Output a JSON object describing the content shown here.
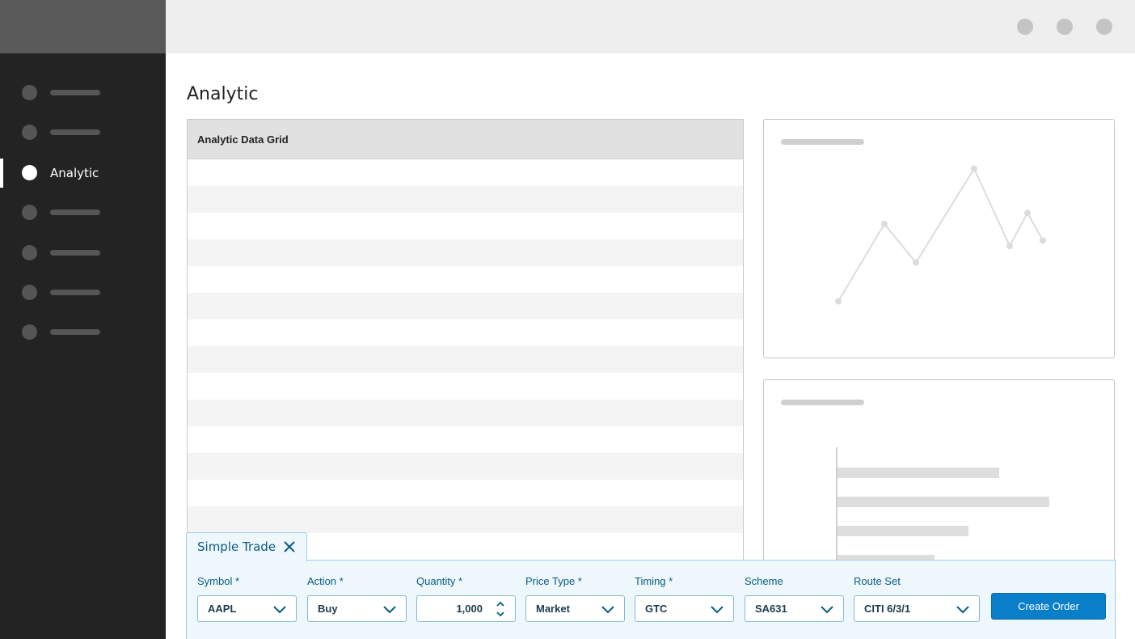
{
  "sidebar": {
    "items": [
      {
        "label": "",
        "active": false
      },
      {
        "label": "",
        "active": false
      },
      {
        "label": "Analytic",
        "active": true
      },
      {
        "label": "",
        "active": false
      },
      {
        "label": "",
        "active": false
      },
      {
        "label": "",
        "active": false
      },
      {
        "label": "",
        "active": false
      }
    ]
  },
  "page": {
    "title": "Analytic"
  },
  "grid": {
    "header": "Analytic Data Grid"
  },
  "line_chart": {
    "points": [
      3,
      17,
      10,
      27,
      13,
      19,
      14
    ]
  },
  "bar_chart": {
    "values": [
      100,
      131,
      81,
      60
    ]
  },
  "trade": {
    "tab_title": "Simple Trade",
    "fields": {
      "symbol": {
        "label": "Symbol *",
        "value": "AAPL"
      },
      "action": {
        "label": "Action *",
        "value": "Buy"
      },
      "quantity": {
        "label": "Quantity *",
        "value": "1,000"
      },
      "price_type": {
        "label": "Price Type *",
        "value": "Market"
      },
      "timing": {
        "label": "Timing *",
        "value": "GTC"
      },
      "scheme": {
        "label": "Scheme",
        "value": "SA631"
      },
      "route_set": {
        "label": "Route Set",
        "value": "CITI 6/3/1"
      }
    },
    "create_label": "Create Order"
  },
  "colors": {
    "accent": "#0a7fc9",
    "label_text": "#0a5a82",
    "panel_bg": "#eef7fb",
    "sidebar_bg": "#232323"
  }
}
